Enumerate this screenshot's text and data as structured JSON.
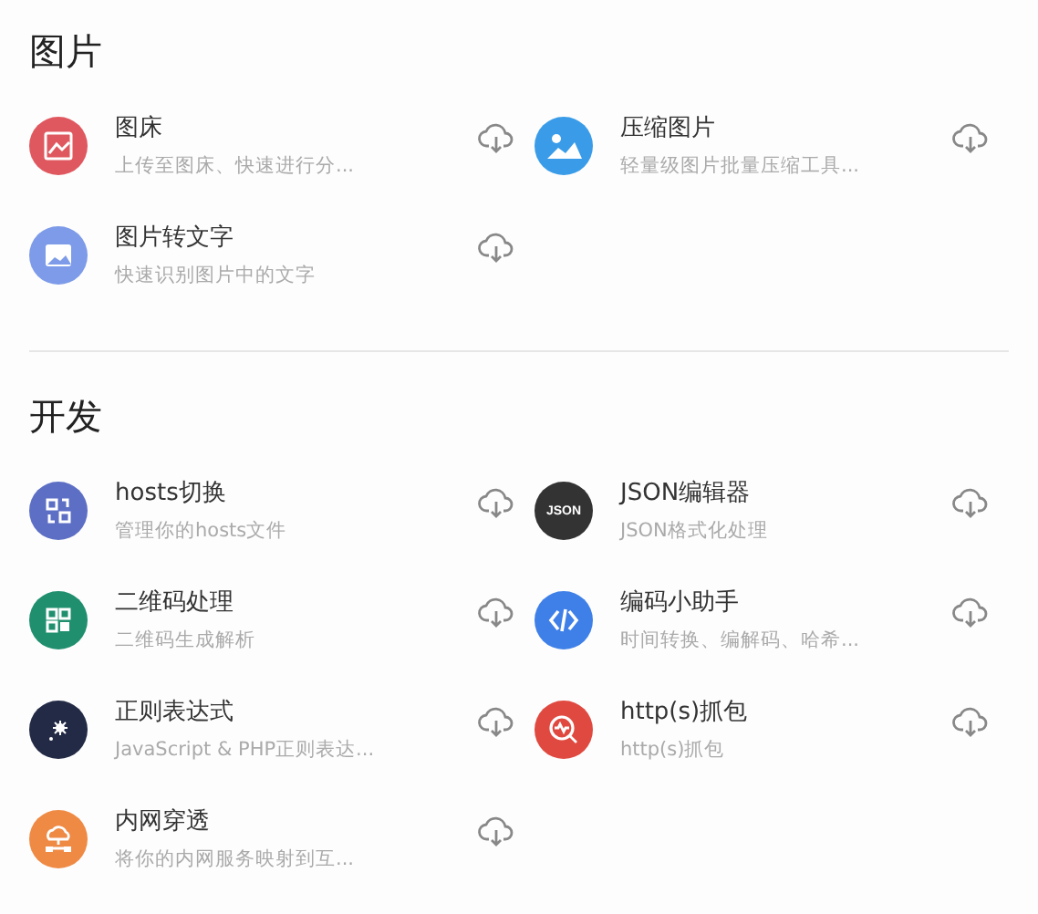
{
  "sections": [
    {
      "title": "图片",
      "items": [
        {
          "name": "图床",
          "description": "上传至图床、快速进行分...",
          "kind": "image-edit",
          "color": "#e0585f"
        },
        {
          "name": "压缩图片",
          "description": "轻量级图片批量压缩工具...",
          "kind": "image",
          "color": "#3a9ce8"
        },
        {
          "name": "图片转文字",
          "description": "快速识别图片中的文字",
          "kind": "photo",
          "color": "#7d9be8"
        }
      ]
    },
    {
      "title": "开发",
      "items": [
        {
          "name": "hosts切换",
          "description": "管理你的hosts文件",
          "kind": "swap",
          "color": "#5c6fc4"
        },
        {
          "name": "JSON编辑器",
          "description": "JSON格式化处理",
          "kind": "label",
          "icon_text": "JSON",
          "color": "#333333"
        },
        {
          "name": "二维码处理",
          "description": "二维码生成解析",
          "kind": "qr",
          "color": "#1f8f6e"
        },
        {
          "name": "编码小助手",
          "description": "时间转换、编解码、哈希...",
          "kind": "code",
          "color": "#3f80e8"
        },
        {
          "name": "正则表达式",
          "description": "JavaScript & PHP正则表达...",
          "kind": "spark",
          "color": "#222a45"
        },
        {
          "name": "http(s)抓包",
          "description": "http(s)抓包",
          "kind": "magnifier",
          "color": "#e0493f"
        },
        {
          "name": "内网穿透",
          "description": "将你的内网服务映射到互...",
          "kind": "cloud-net",
          "color": "#ef8a45"
        }
      ]
    }
  ]
}
